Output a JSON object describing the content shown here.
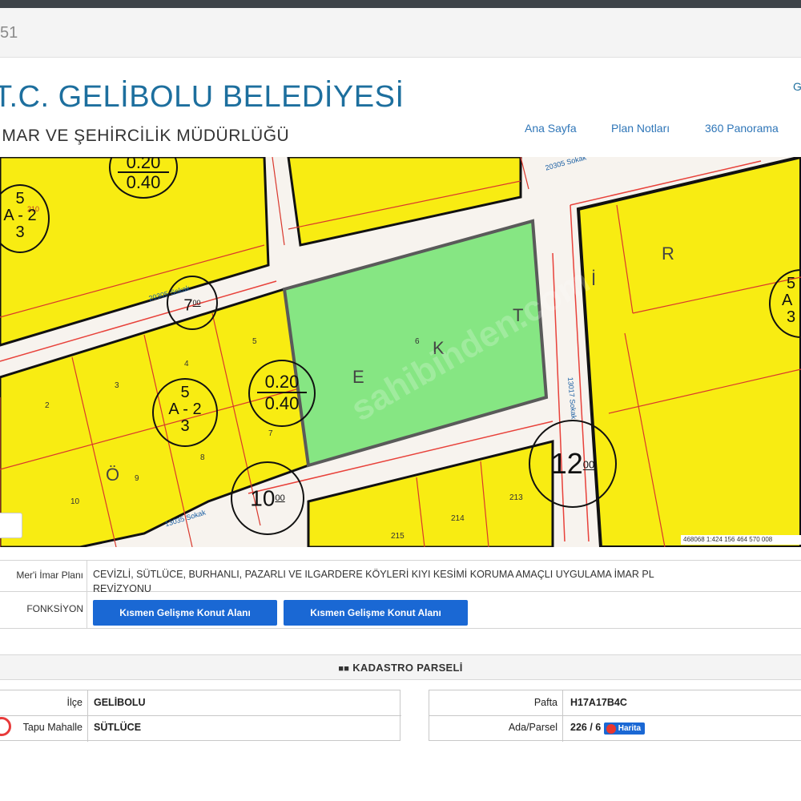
{
  "browser": {
    "tab_number": "51"
  },
  "header": {
    "title": "T.C. GELİBOLU BELEDİYESİ",
    "subtitle": "İMAR VE ŞEHİRCİLİK MÜDÜRLÜĞÜ",
    "corner": "G",
    "nav": [
      "Ana Sayfa",
      "Plan Notları",
      "360 Panorama"
    ]
  },
  "map": {
    "streets": [
      "20305 Sokak",
      "20305 Sokak",
      "13017 Sokak",
      "13035 Sokak"
    ],
    "zoning_labels": [
      "R",
      "E",
      "K",
      "T",
      "İ",
      "Ö"
    ],
    "height_markers": [
      "7",
      "00",
      "12",
      "00",
      "10",
      "00"
    ],
    "ratio_markers": [
      [
        "0.20",
        "0.40"
      ],
      [
        "0.20",
        "0.40"
      ]
    ],
    "aq_markers": [
      [
        "5",
        "A",
        "2",
        "3"
      ],
      [
        "5",
        "A",
        "2",
        "3"
      ],
      [
        "5",
        "A",
        "3"
      ]
    ],
    "parcel_numbers": [
      "2",
      "3",
      "4",
      "5",
      "6",
      "7",
      "8",
      "9",
      "10",
      "213",
      "214",
      "215",
      "210"
    ],
    "scale_text": "468068 1:424 156 464 570 008",
    "watermark": "sahibinden.com"
  },
  "plan": {
    "label": "Mer'i İmar Planı",
    "text_line1": "CEVİZLİ, SÜTLÜCE, BURHANLI, PAZARLI VE ILGARDERE KÖYLERİ KIYI KESİMİ KORUMA AMAÇLI UYGULAMA İMAR PL",
    "text_line2": "REVİZYONU",
    "function_label": "FONKSİYON",
    "functions": [
      "Kısmen Gelişme Konut Alanı",
      "Kısmen Gelişme Konut Alanı"
    ]
  },
  "kadastro": {
    "heading": "KADASTRO PARSELİ",
    "left": [
      {
        "label": "İlçe",
        "value": "GELİBOLU"
      },
      {
        "label": "Tapu Mahalle",
        "value": "SÜTLÜCE"
      }
    ],
    "right": [
      {
        "label": "Pafta",
        "value": "H17A17B4C"
      },
      {
        "label": "Ada/Parsel",
        "value": "226 / 6"
      }
    ],
    "map_button": "Harita"
  },
  "colors": {
    "title": "#1d6f9e",
    "nav_link": "#2f76b8",
    "zone_yellow": "#f8ec12",
    "green_parcel": "#86e683",
    "button_blue": "#1a68d4",
    "road_red": "#e8413a"
  }
}
